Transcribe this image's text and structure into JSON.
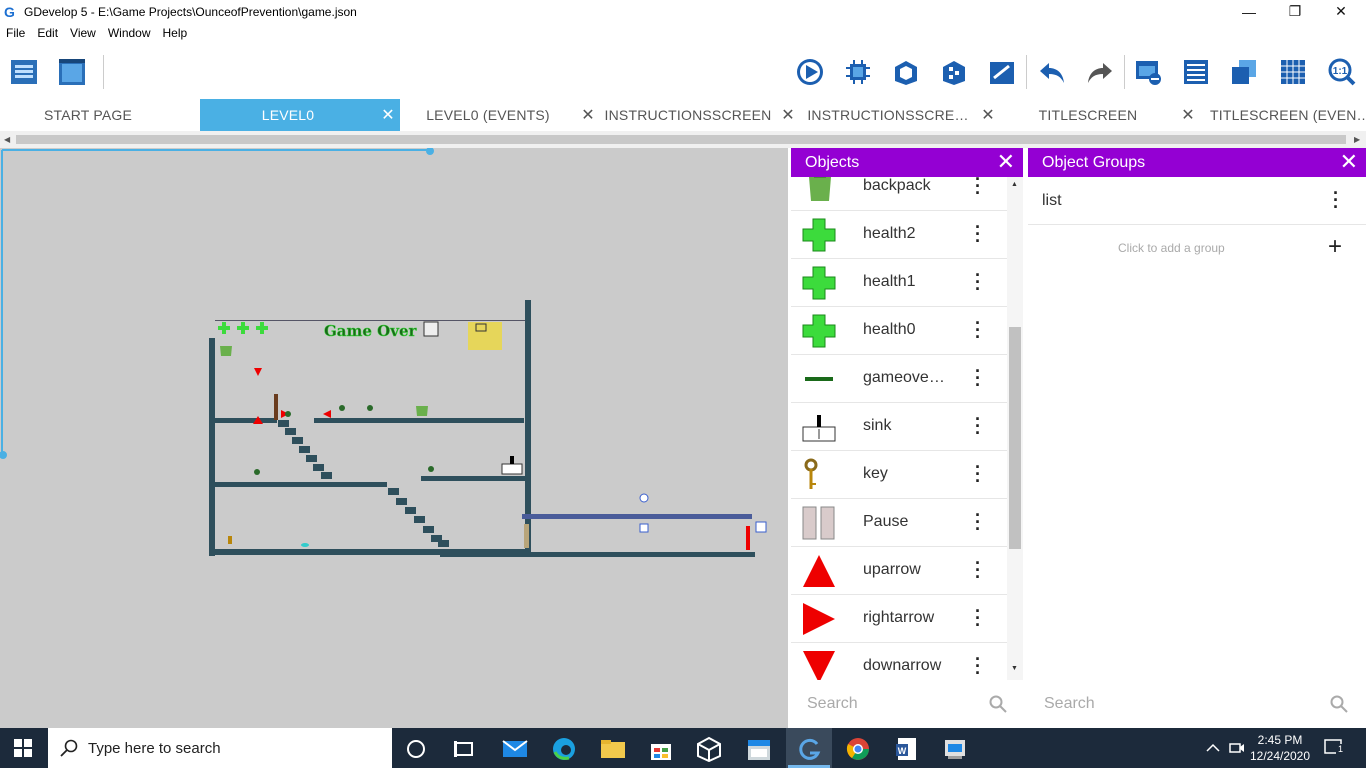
{
  "window": {
    "title": "GDevelop 5 - E:\\Game Projects\\OunceofPrevention\\game.json",
    "min": "—",
    "restore": "❐",
    "close": "✕"
  },
  "menu": [
    "File",
    "Edit",
    "View",
    "Window",
    "Help"
  ],
  "tabs": [
    "START PAGE",
    "LEVEL0",
    "LEVEL0 (EVENTS)",
    "INSTRUCTIONSSCREEN",
    "INSTRUCTIONSSCRE…",
    "TITLESCREEN",
    "TITLESCREEN (EVEN…"
  ],
  "tab_close": "✕",
  "toolbar_icons": [
    "project-manager-icon",
    "scene-editor-icon",
    "preview-play-icon",
    "debugger-icon",
    "open-scene-icon",
    "instances-icon",
    "properties-icon",
    "undo-icon",
    "redo-icon",
    "layers-icon",
    "instances-list-icon",
    "objects-list-icon",
    "grid-icon",
    "zoom-reset-icon"
  ],
  "scene": {
    "game_over_text": "Game Over"
  },
  "objects_panel": {
    "title": "Objects",
    "close": "✕",
    "items": [
      {
        "name": "backpack",
        "icon": "backpack-icon"
      },
      {
        "name": "health2",
        "icon": "green-cross-icon"
      },
      {
        "name": "health1",
        "icon": "green-cross-icon"
      },
      {
        "name": "health0",
        "icon": "green-cross-icon"
      },
      {
        "name": "gameove…",
        "icon": "gameover-text-icon"
      },
      {
        "name": "sink",
        "icon": "sink-icon"
      },
      {
        "name": "key",
        "icon": "key-icon"
      },
      {
        "name": "Pause",
        "icon": "pause-icon"
      },
      {
        "name": "uparrow",
        "icon": "red-up-arrow-icon"
      },
      {
        "name": "rightarrow",
        "icon": "red-right-arrow-icon"
      },
      {
        "name": "downarrow",
        "icon": "red-down-arrow-icon"
      }
    ],
    "search_placeholder": "Search"
  },
  "groups_panel": {
    "title": "Object Groups",
    "close": "✕",
    "items": [
      {
        "name": "list"
      }
    ],
    "add_hint": "Click to add a group",
    "add": "+",
    "search_placeholder": "Search"
  },
  "taskbar": {
    "search_placeholder": "Type here to search",
    "time": "2:45 PM",
    "date": "12/24/2020",
    "notifications": "1"
  },
  "colors": {
    "accent_tab": "#4ab0e4",
    "panel_header": "#9400d3",
    "scene_bg": "#cbcbcb",
    "taskbar": "#1c2a3b"
  }
}
